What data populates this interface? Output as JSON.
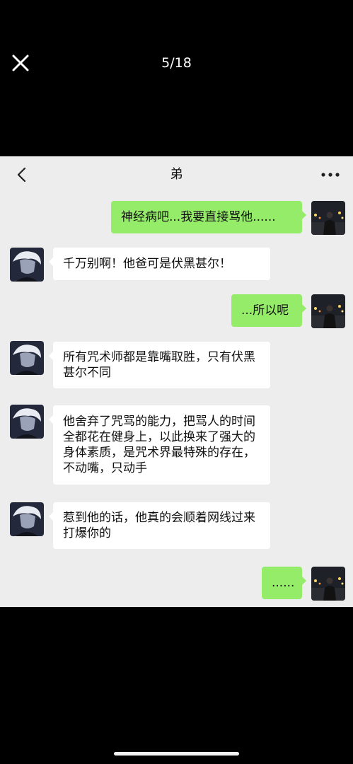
{
  "viewer": {
    "counter": "5/18",
    "close_icon": "close-icon"
  },
  "chat": {
    "title": "弟",
    "back_icon": "chevron-left-icon",
    "more_icon": "more-dots-icon",
    "messages": [
      {
        "side": "me",
        "text": "神经病吧...我要直接骂他......"
      },
      {
        "side": "them",
        "text": "千万别啊！他爸可是伏黑甚尔！"
      },
      {
        "side": "me",
        "text": "...所以呢"
      },
      {
        "side": "them",
        "text": "所有咒术师都是靠嘴取胜，只有伏黑甚尔不同"
      },
      {
        "side": "them",
        "text": "他舍弃了咒骂的能力，把骂人的时间全都花在健身上，以此换来了强大的身体素质，是咒术界最特殊的存在，不动嘴，只动手"
      },
      {
        "side": "them",
        "text": "惹到他的话，他真的会顺着网线过来打爆你的"
      },
      {
        "side": "me",
        "text": "......"
      }
    ]
  },
  "colors": {
    "viewer_background": "#000000",
    "chat_background": "#ededed",
    "my_bubble": "#95ec69",
    "their_bubble": "#ffffff"
  }
}
